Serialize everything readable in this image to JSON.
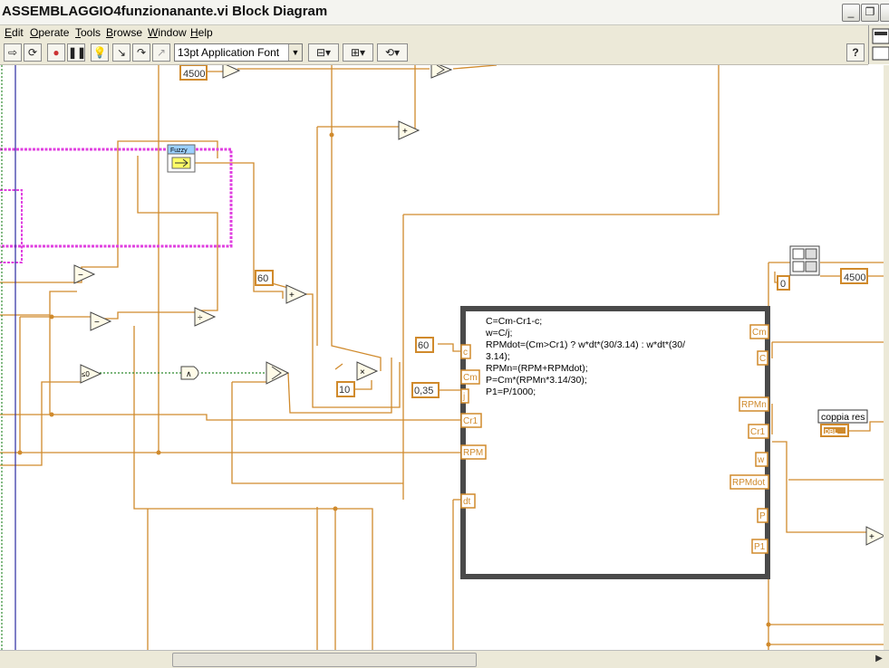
{
  "window": {
    "title": "ASSEMBLAGGIO4funzionanante.vi Block Diagram",
    "minimize": "_",
    "restore": "❐",
    "close": "✕"
  },
  "menu": [
    "Edit",
    "Operate",
    "Tools",
    "Browse",
    "Window",
    "Help"
  ],
  "toolbar": {
    "font": "13pt Application Font",
    "help": "?"
  },
  "diagram": {
    "constants": {
      "c4500_left": "4500",
      "c60_mid": "60",
      "c60_formula": "60",
      "c035": "0,35",
      "c10": "10",
      "c0": "0",
      "c4500_right": "4500"
    },
    "fuzzy_label": "Fuzzy",
    "formula_inputs": [
      "c",
      "Cm",
      "j",
      "Cr1",
      "RPM",
      "dt"
    ],
    "formula_outputs": [
      "Cm",
      "C",
      "RPMn",
      "Cr1",
      "w",
      "RPMdot",
      "P",
      "P1"
    ],
    "formula_code": [
      "C=Cm-Cr1-c;",
      "w=C/j;",
      "RPMdot=(Cm>Cr1) ? w*dt*(30/3.14) : w*dt*(30/",
      "3.14);",
      "RPMn=(RPM+RPMdot);",
      "P=Cm*(RPMn*3.14/30);",
      "P1=P/1000;"
    ],
    "ops": {
      "subtract1": "−",
      "subtract2": "−",
      "add1": "+",
      "add2": "+",
      "add3": "+",
      "multiply": "×",
      "divide": "÷",
      "compare_zero": "≤0",
      "and": "∧"
    },
    "indicator_label": "coppia res",
    "indicator_type": "DBL"
  },
  "colors": {
    "wire": "#d08a2c",
    "pink_wire": "#e040e0",
    "green_wire": "#2e8b2e",
    "blue_line": "#2a2aa0",
    "formula_frame": "#4a4a4a"
  }
}
